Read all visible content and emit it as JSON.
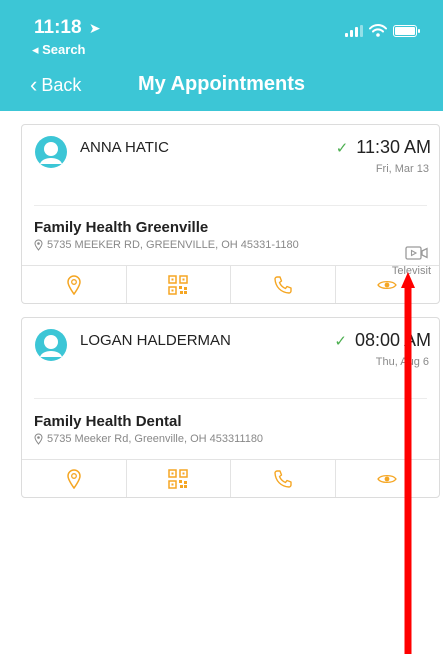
{
  "status_bar": {
    "time": "11:18",
    "back_app": "◂ Search"
  },
  "nav": {
    "back_label": "Back",
    "title": "My Appointments"
  },
  "appointments": [
    {
      "patient": "ANNA HATIC",
      "time": "11:30 AM",
      "date": "Fri, Mar 13",
      "clinic": "Family Health Greenville",
      "address": "5735 MEEKER RD, GREENVILLE, OH 45331-1180",
      "visit_type": "Televisit",
      "visit_icon": "video-icon"
    },
    {
      "patient": "LOGAN HALDERMAN",
      "time": "08:00 AM",
      "date": "Thu, Aug 6",
      "clinic": "Family Health Dental",
      "address": "5735 Meeker Rd, Greenville, OH 453311180"
    }
  ],
  "actions": [
    "location-pin-icon",
    "qr-code-icon",
    "phone-icon",
    "eye-icon"
  ],
  "colors": {
    "header": "#3cc6d6",
    "accent": "#f5a623",
    "check": "#4caf50",
    "annotation_arrow": "#ff0000"
  }
}
